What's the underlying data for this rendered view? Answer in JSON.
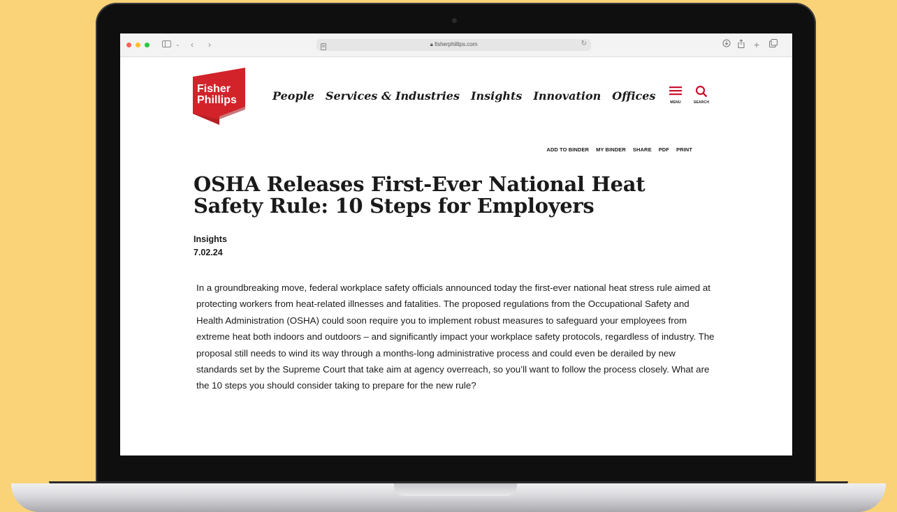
{
  "browser": {
    "url": "fisherphillips.com"
  },
  "site": {
    "logo_line1": "Fisher",
    "logo_line2": "Phillips",
    "brand_color": "#c8102e",
    "nav": [
      "People",
      "Services & Industries",
      "Insights",
      "Innovation",
      "Offices"
    ],
    "menu_label": "MENU",
    "search_label": "SEARCH"
  },
  "article_tools": [
    "ADD TO BINDER",
    "MY BINDER",
    "SHARE",
    "PDF",
    "PRINT"
  ],
  "article": {
    "title": "OSHA Releases First-Ever National Heat Safety Rule: 10 Steps for Employers",
    "category": "Insights",
    "date": "7.02.24",
    "body": "In a groundbreaking move, federal workplace safety officials announced today the first-ever national heat stress rule aimed at protecting workers from heat-related illnesses and fatalities. The proposed regulations from the Occupational Safety and Health Administration (OSHA) could soon require you to implement robust measures to safeguard your employees from extreme heat both indoors and outdoors – and significantly impact your workplace safety protocols, regardless of industry. The proposal still needs to wind its way through a months-long administrative process and could even be derailed by new standards set by the Supreme Court that take aim at agency overreach, so you’ll want to follow the process closely. What are the 10 steps you should consider taking to prepare for the new rule?"
  },
  "icons": [
    "close-dot-icon",
    "minimize-dot-icon",
    "zoom-dot-icon",
    "sidebar-icon",
    "chevron-down-icon",
    "back-icon",
    "forward-icon",
    "reader-icon",
    "lock-icon",
    "reload-icon",
    "download-icon",
    "share-icon",
    "new-tab-icon",
    "tabs-icon",
    "hamburger-icon",
    "search-icon"
  ]
}
